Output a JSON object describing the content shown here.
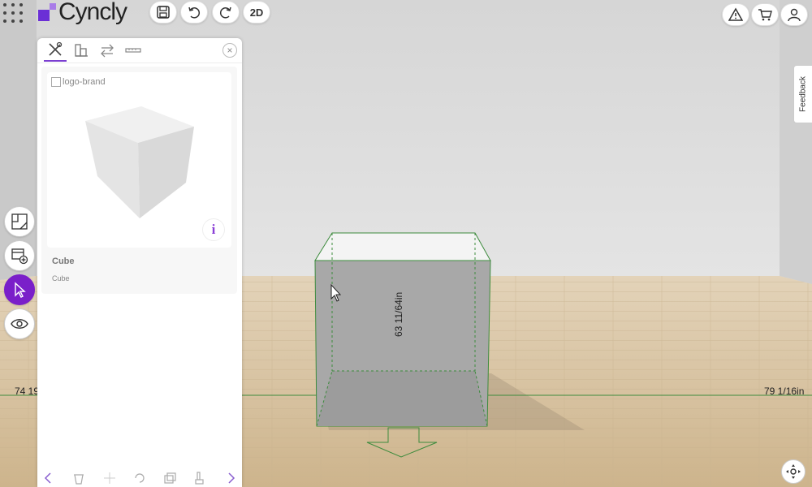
{
  "app": {
    "logo_text": "Cyncly",
    "brand_color": "#6b2fd6"
  },
  "toolbar": {
    "save_icon": "save-icon",
    "undo_icon": "undo-icon",
    "redo_icon": "redo-icon",
    "view_toggle_label": "2D",
    "right_icons": [
      "warning-icon",
      "cart-icon",
      "user-icon"
    ]
  },
  "panel": {
    "tabs": [
      "tools-icon",
      "catalog-icon",
      "swap-icon",
      "ruler-icon"
    ],
    "item": {
      "image_alt": "logo-brand",
      "title": "Cube",
      "subtitle": "Cube",
      "info_label": "i"
    },
    "bottom_icons": [
      "chevron-left-icon",
      "delete-icon",
      "move-icon",
      "rotate-icon",
      "duplicate-icon",
      "paint-icon",
      "chevron-right-icon"
    ]
  },
  "side_tools": [
    "floorplan-icon",
    "add-catalog-icon",
    "pointer-icon",
    "eye-icon"
  ],
  "feedback": {
    "label": "Feedback"
  },
  "dimensions": {
    "left": "74 19",
    "right": "79 1/16in",
    "height": "63 11/64in"
  },
  "colors": {
    "accent": "#7a1fc9",
    "guide": "#3d8b3d"
  }
}
